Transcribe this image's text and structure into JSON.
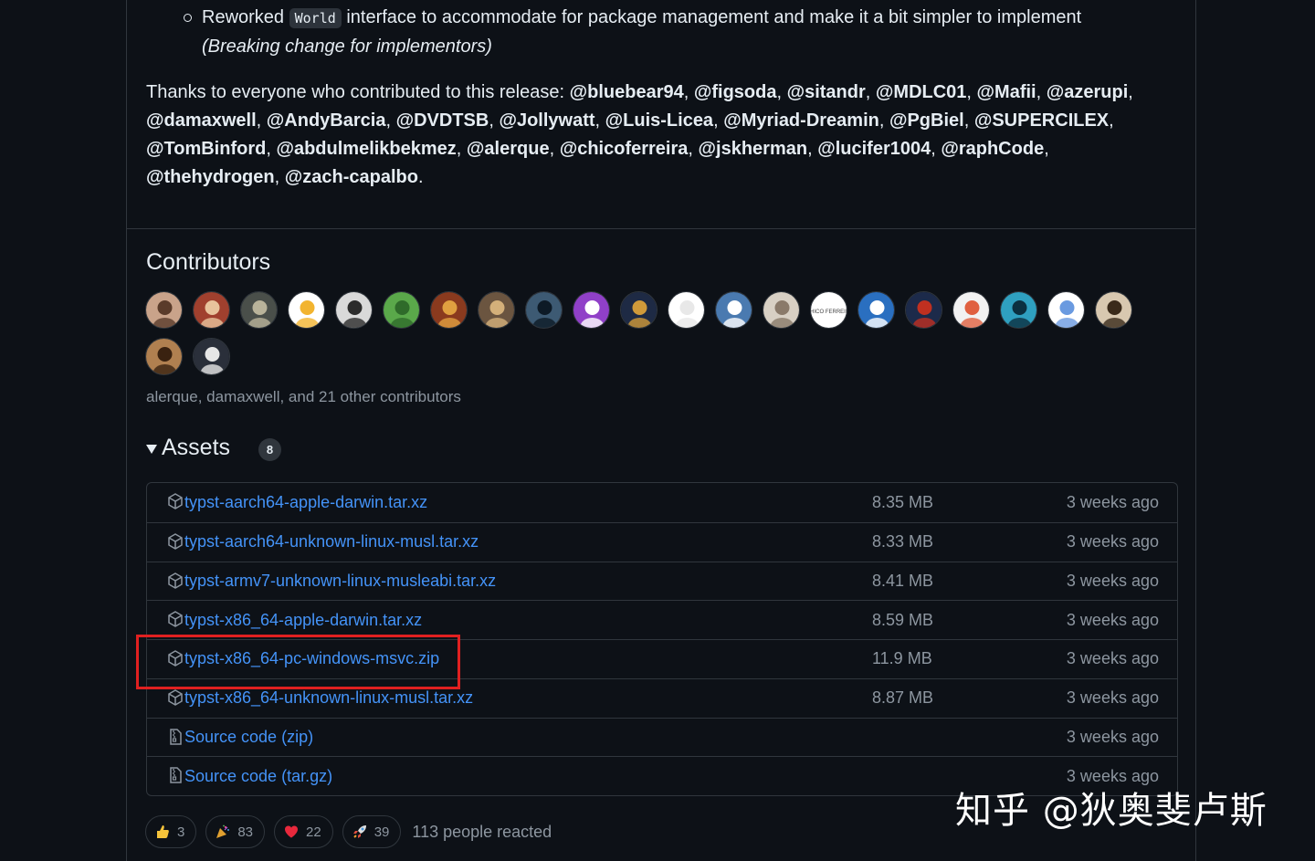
{
  "release_notes": {
    "bullet": {
      "prefix": "Reworked",
      "code": "World",
      "suffix": "interface to accommodate for package management and make it a bit simpler to implement",
      "note": "(Breaking change for implementors)"
    },
    "thanks_prefix": "Thanks to everyone who contributed to this release:",
    "mentions": [
      "@bluebear94",
      "@figsoda",
      "@sitandr",
      "@MDLC01",
      "@Mafii",
      "@azerupi",
      "@damaxwell",
      "@AndyBarcia",
      "@DVDTSB",
      "@Jollywatt",
      "@Luis-Licea",
      "@Myriad-Dreamin",
      "@PgBiel",
      "@SUPERCILEX",
      "@TomBinford",
      "@abdulmelikbekmez",
      "@alerque",
      "@chicoferreira",
      "@jskherman",
      "@lucifer1004",
      "@raphCode",
      "@thehydrogen",
      "@zach-capalbo"
    ]
  },
  "contributors": {
    "title": "Contributors",
    "avatars": [
      {
        "bg": "#c9a38a",
        "fg": "#5a3b2a"
      },
      {
        "bg": "#a0402e",
        "fg": "#e8c39c"
      },
      {
        "bg": "#4a4f4a",
        "fg": "#b9b39a"
      },
      {
        "bg": "#ffffff",
        "fg": "#f2b430"
      },
      {
        "bg": "#d9d9d9",
        "fg": "#2b2b2b"
      },
      {
        "bg": "#5aa84a",
        "fg": "#2f6b2a"
      },
      {
        "bg": "#8a3a1e",
        "fg": "#e0a040"
      },
      {
        "bg": "#6b5540",
        "fg": "#d4b07a"
      },
      {
        "bg": "#3d5a73",
        "fg": "#0d1a26"
      },
      {
        "bg": "#9040c8",
        "fg": "#ffffff"
      },
      {
        "bg": "#1e2a44",
        "fg": "#d09a3a"
      },
      {
        "bg": "#ffffff",
        "fg": "#e8e8e8"
      },
      {
        "bg": "#4a7ab0",
        "fg": "#ffffff"
      },
      {
        "bg": "#d8d0c4",
        "fg": "#8a7a6a"
      },
      {
        "bg": "#ffffff",
        "fg": "#444444",
        "text": "CHICO FERREIRA"
      },
      {
        "bg": "#2a6fc0",
        "fg": "#ffffff"
      },
      {
        "bg": "#1c2a4a",
        "fg": "#c03020"
      },
      {
        "bg": "#f2f2f2",
        "fg": "#e06040"
      },
      {
        "bg": "#2fa0c0",
        "fg": "#0b3040"
      },
      {
        "bg": "#ffffff",
        "fg": "#6a9ae0"
      },
      {
        "bg": "#d8c8b0",
        "fg": "#3a2a1a"
      },
      {
        "bg": "#b08050",
        "fg": "#3a2210"
      },
      {
        "bg": "#2a2f3a",
        "fg": "#e6e6e6"
      }
    ],
    "summary": "alerque, damaxwell, and 21 other contributors"
  },
  "assets": {
    "title": "Assets",
    "count": "8",
    "items": [
      {
        "name": "typst-aarch64-apple-darwin.tar.xz",
        "size": "8.35 MB",
        "date": "3 weeks ago",
        "kind": "package"
      },
      {
        "name": "typst-aarch64-unknown-linux-musl.tar.xz",
        "size": "8.33 MB",
        "date": "3 weeks ago",
        "kind": "package"
      },
      {
        "name": "typst-armv7-unknown-linux-musleabi.tar.xz",
        "size": "8.41 MB",
        "date": "3 weeks ago",
        "kind": "package"
      },
      {
        "name": "typst-x86_64-apple-darwin.tar.xz",
        "size": "8.59 MB",
        "date": "3 weeks ago",
        "kind": "package"
      },
      {
        "name": "typst-x86_64-pc-windows-msvc.zip",
        "size": "11.9 MB",
        "date": "3 weeks ago",
        "kind": "package"
      },
      {
        "name": "typst-x86_64-unknown-linux-musl.tar.xz",
        "size": "8.87 MB",
        "date": "3 weeks ago",
        "kind": "package"
      },
      {
        "name": "Source code",
        "suffix": "(zip)",
        "size": "",
        "date": "3 weeks ago",
        "kind": "zip"
      },
      {
        "name": "Source code",
        "suffix": "(tar.gz)",
        "size": "",
        "date": "3 weeks ago",
        "kind": "zip"
      }
    ]
  },
  "reactions": {
    "items": [
      {
        "emoji": "thumbs-up",
        "count": "3"
      },
      {
        "emoji": "party-popper",
        "count": "83"
      },
      {
        "emoji": "heart",
        "count": "22"
      },
      {
        "emoji": "rocket",
        "count": "39"
      }
    ],
    "summary": "113 people reacted"
  },
  "watermark": "知乎 @狄奥斐卢斯",
  "colors": {
    "link": "#4493f8",
    "muted": "#8d96a0",
    "background": "#0d1117",
    "border": "#30363d",
    "highlight": "#e02020"
  }
}
